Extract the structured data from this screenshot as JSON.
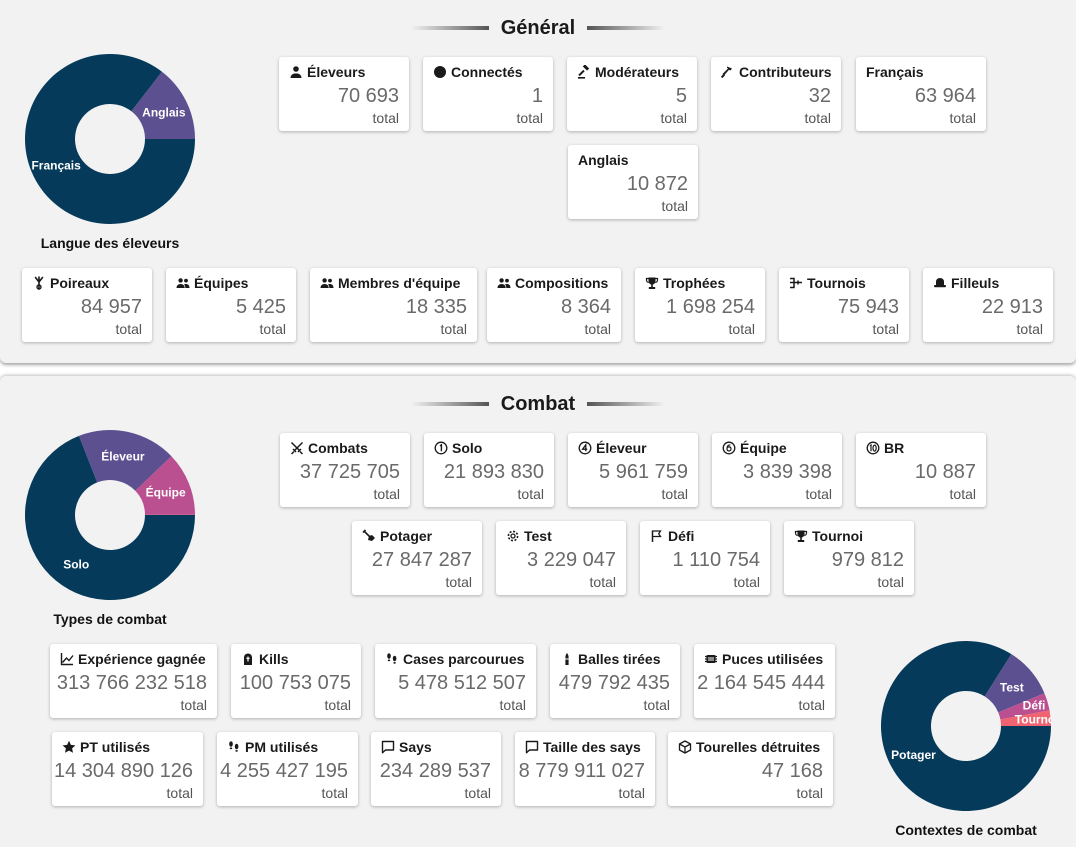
{
  "general": {
    "title": "Général",
    "chart": {
      "title": "Langue des éleveurs"
    },
    "cards": [
      {
        "label": "Éleveurs",
        "icon": "person-icon",
        "value": "70 693",
        "unit": "total"
      },
      {
        "label": "Connectés",
        "icon": "dot-icon",
        "value": "1",
        "unit": "total"
      },
      {
        "label": "Modérateurs",
        "icon": "gavel-icon",
        "value": "5",
        "unit": "total"
      },
      {
        "label": "Contributeurs",
        "icon": "hammer-icon",
        "value": "32",
        "unit": "total"
      },
      {
        "label": "Français",
        "icon": "",
        "value": "63 964",
        "unit": "total"
      },
      {
        "label": "Anglais",
        "icon": "",
        "value": "10 872",
        "unit": "total"
      },
      {
        "label": "Poireaux",
        "icon": "leek-icon",
        "value": "84 957",
        "unit": "total"
      },
      {
        "label": "Équipes",
        "icon": "group-icon",
        "value": "5 425",
        "unit": "total"
      },
      {
        "label": "Membres d'équipe",
        "icon": "group-icon",
        "value": "18 335",
        "unit": "total"
      },
      {
        "label": "Compositions",
        "icon": "group-icon",
        "value": "8 364",
        "unit": "total"
      },
      {
        "label": "Trophées",
        "icon": "trophy-icon",
        "value": "1 698 254",
        "unit": "total"
      },
      {
        "label": "Tournois",
        "icon": "bracket-icon",
        "value": "75 943",
        "unit": "total"
      },
      {
        "label": "Filleuls",
        "icon": "hat-icon",
        "value": "22 913",
        "unit": "total"
      }
    ]
  },
  "combat": {
    "title": "Combat",
    "cards": [
      {
        "label": "Combats",
        "icon": "swords-icon",
        "value": "37 725 705",
        "unit": "total"
      },
      {
        "label": "Solo",
        "icon": "circle-1-icon",
        "value": "21 893 830",
        "unit": "total"
      },
      {
        "label": "Éleveur",
        "icon": "circle-4-icon",
        "value": "5 961 759",
        "unit": "total"
      },
      {
        "label": "Équipe",
        "icon": "circle-6-icon",
        "value": "3 839 398",
        "unit": "total"
      },
      {
        "label": "BR",
        "icon": "circle-10-icon",
        "value": "10 887",
        "unit": "total"
      },
      {
        "label": "Potager",
        "icon": "shovel-icon",
        "value": "27 847 287",
        "unit": "total"
      },
      {
        "label": "Test",
        "icon": "gear-icon",
        "value": "3 229 047",
        "unit": "total"
      },
      {
        "label": "Défi",
        "icon": "flag-icon",
        "value": "1 110 754",
        "unit": "total"
      },
      {
        "label": "Tournoi",
        "icon": "trophy-icon",
        "value": "979 812",
        "unit": "total"
      },
      {
        "label": "Expérience gagnée",
        "icon": "chart-line-icon",
        "value": "313 766 232 518",
        "unit": "total"
      },
      {
        "label": "Kills",
        "icon": "tombstone-icon",
        "value": "100 753 075",
        "unit": "total"
      },
      {
        "label": "Cases parcourues",
        "icon": "footsteps-icon",
        "value": "5 478 512 507",
        "unit": "total"
      },
      {
        "label": "Balles tirées",
        "icon": "bullet-icon",
        "value": "479 792 435",
        "unit": "total"
      },
      {
        "label": "Puces utilisées",
        "icon": "chip-icon",
        "value": "2 164 545 444",
        "unit": "total"
      },
      {
        "label": "PT utilisés",
        "icon": "star-icon",
        "value": "14 304 890 126",
        "unit": "total"
      },
      {
        "label": "PM utilisés",
        "icon": "footsteps-icon",
        "value": "4 255 427 195",
        "unit": "total"
      },
      {
        "label": "Says",
        "icon": "speech-bubble-icon",
        "value": "234 289 537",
        "unit": "total"
      },
      {
        "label": "Taille des says",
        "icon": "speech-bubble-icon",
        "value": "8 779 911 027",
        "unit": "total"
      },
      {
        "label": "Tourelles détruites",
        "icon": "cube-icon",
        "value": "47 168",
        "unit": "total"
      }
    ]
  },
  "colors": {
    "navy": "#053a5a",
    "purple": "#5c5090",
    "pink": "#bb5090",
    "salmon": "#ef6470",
    "panel_bg": "#f2f2f2"
  },
  "chart_data": [
    {
      "type": "pie",
      "title": "Langue des éleveurs",
      "categories": [
        "Français",
        "Anglais"
      ],
      "values": [
        63964,
        10872
      ],
      "colors": [
        "#053a5a",
        "#5c5090"
      ]
    },
    {
      "type": "pie",
      "title": "Types de combat",
      "categories": [
        "Solo",
        "Éleveur",
        "Équipe",
        "BR"
      ],
      "values": [
        21893830,
        5961759,
        3839398,
        10887
      ],
      "colors": [
        "#053a5a",
        "#5c5090",
        "#bb5090",
        "#ef6470"
      ],
      "labels": [
        "Solo",
        "Éleveur",
        "Équipe",
        ""
      ]
    },
    {
      "type": "pie",
      "title": "Contextes de combat",
      "categories": [
        "Potager",
        "Test",
        "Défi",
        "Tournoi"
      ],
      "values": [
        27847287,
        3229047,
        1110754,
        979812
      ],
      "colors": [
        "#053a5a",
        "#5c5090",
        "#bb5090",
        "#ef6470"
      ]
    }
  ]
}
